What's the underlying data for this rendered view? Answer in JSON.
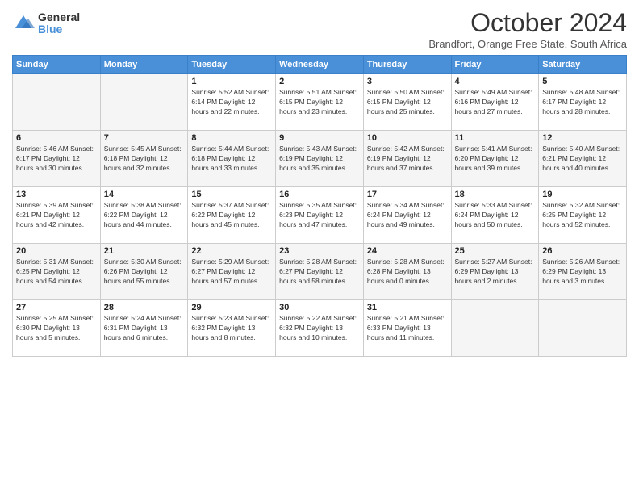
{
  "logo": {
    "general": "General",
    "blue": "Blue"
  },
  "header": {
    "month": "October 2024",
    "location": "Brandfort, Orange Free State, South Africa"
  },
  "weekdays": [
    "Sunday",
    "Monday",
    "Tuesday",
    "Wednesday",
    "Thursday",
    "Friday",
    "Saturday"
  ],
  "weeks": [
    [
      {
        "day": "",
        "info": ""
      },
      {
        "day": "",
        "info": ""
      },
      {
        "day": "1",
        "info": "Sunrise: 5:52 AM\nSunset: 6:14 PM\nDaylight: 12 hours\nand 22 minutes."
      },
      {
        "day": "2",
        "info": "Sunrise: 5:51 AM\nSunset: 6:15 PM\nDaylight: 12 hours\nand 23 minutes."
      },
      {
        "day": "3",
        "info": "Sunrise: 5:50 AM\nSunset: 6:15 PM\nDaylight: 12 hours\nand 25 minutes."
      },
      {
        "day": "4",
        "info": "Sunrise: 5:49 AM\nSunset: 6:16 PM\nDaylight: 12 hours\nand 27 minutes."
      },
      {
        "day": "5",
        "info": "Sunrise: 5:48 AM\nSunset: 6:17 PM\nDaylight: 12 hours\nand 28 minutes."
      }
    ],
    [
      {
        "day": "6",
        "info": "Sunrise: 5:46 AM\nSunset: 6:17 PM\nDaylight: 12 hours\nand 30 minutes."
      },
      {
        "day": "7",
        "info": "Sunrise: 5:45 AM\nSunset: 6:18 PM\nDaylight: 12 hours\nand 32 minutes."
      },
      {
        "day": "8",
        "info": "Sunrise: 5:44 AM\nSunset: 6:18 PM\nDaylight: 12 hours\nand 33 minutes."
      },
      {
        "day": "9",
        "info": "Sunrise: 5:43 AM\nSunset: 6:19 PM\nDaylight: 12 hours\nand 35 minutes."
      },
      {
        "day": "10",
        "info": "Sunrise: 5:42 AM\nSunset: 6:19 PM\nDaylight: 12 hours\nand 37 minutes."
      },
      {
        "day": "11",
        "info": "Sunrise: 5:41 AM\nSunset: 6:20 PM\nDaylight: 12 hours\nand 39 minutes."
      },
      {
        "day": "12",
        "info": "Sunrise: 5:40 AM\nSunset: 6:21 PM\nDaylight: 12 hours\nand 40 minutes."
      }
    ],
    [
      {
        "day": "13",
        "info": "Sunrise: 5:39 AM\nSunset: 6:21 PM\nDaylight: 12 hours\nand 42 minutes."
      },
      {
        "day": "14",
        "info": "Sunrise: 5:38 AM\nSunset: 6:22 PM\nDaylight: 12 hours\nand 44 minutes."
      },
      {
        "day": "15",
        "info": "Sunrise: 5:37 AM\nSunset: 6:22 PM\nDaylight: 12 hours\nand 45 minutes."
      },
      {
        "day": "16",
        "info": "Sunrise: 5:35 AM\nSunset: 6:23 PM\nDaylight: 12 hours\nand 47 minutes."
      },
      {
        "day": "17",
        "info": "Sunrise: 5:34 AM\nSunset: 6:24 PM\nDaylight: 12 hours\nand 49 minutes."
      },
      {
        "day": "18",
        "info": "Sunrise: 5:33 AM\nSunset: 6:24 PM\nDaylight: 12 hours\nand 50 minutes."
      },
      {
        "day": "19",
        "info": "Sunrise: 5:32 AM\nSunset: 6:25 PM\nDaylight: 12 hours\nand 52 minutes."
      }
    ],
    [
      {
        "day": "20",
        "info": "Sunrise: 5:31 AM\nSunset: 6:25 PM\nDaylight: 12 hours\nand 54 minutes."
      },
      {
        "day": "21",
        "info": "Sunrise: 5:30 AM\nSunset: 6:26 PM\nDaylight: 12 hours\nand 55 minutes."
      },
      {
        "day": "22",
        "info": "Sunrise: 5:29 AM\nSunset: 6:27 PM\nDaylight: 12 hours\nand 57 minutes."
      },
      {
        "day": "23",
        "info": "Sunrise: 5:28 AM\nSunset: 6:27 PM\nDaylight: 12 hours\nand 58 minutes."
      },
      {
        "day": "24",
        "info": "Sunrise: 5:28 AM\nSunset: 6:28 PM\nDaylight: 13 hours\nand 0 minutes."
      },
      {
        "day": "25",
        "info": "Sunrise: 5:27 AM\nSunset: 6:29 PM\nDaylight: 13 hours\nand 2 minutes."
      },
      {
        "day": "26",
        "info": "Sunrise: 5:26 AM\nSunset: 6:29 PM\nDaylight: 13 hours\nand 3 minutes."
      }
    ],
    [
      {
        "day": "27",
        "info": "Sunrise: 5:25 AM\nSunset: 6:30 PM\nDaylight: 13 hours\nand 5 minutes."
      },
      {
        "day": "28",
        "info": "Sunrise: 5:24 AM\nSunset: 6:31 PM\nDaylight: 13 hours\nand 6 minutes."
      },
      {
        "day": "29",
        "info": "Sunrise: 5:23 AM\nSunset: 6:32 PM\nDaylight: 13 hours\nand 8 minutes."
      },
      {
        "day": "30",
        "info": "Sunrise: 5:22 AM\nSunset: 6:32 PM\nDaylight: 13 hours\nand 10 minutes."
      },
      {
        "day": "31",
        "info": "Sunrise: 5:21 AM\nSunset: 6:33 PM\nDaylight: 13 hours\nand 11 minutes."
      },
      {
        "day": "",
        "info": ""
      },
      {
        "day": "",
        "info": ""
      }
    ]
  ]
}
